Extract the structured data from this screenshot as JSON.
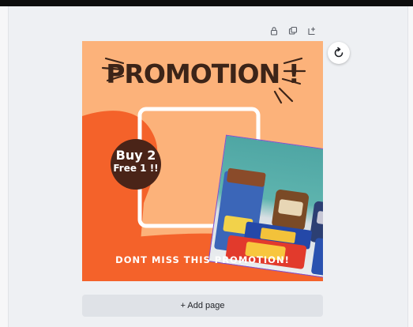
{
  "page_toolbar": {
    "icons": [
      "lock-icon",
      "duplicate-icon",
      "add-page-icon"
    ]
  },
  "design": {
    "title": "PROMOTION !",
    "badge_line1": "Buy 2",
    "badge_line2": "Free 1 !!",
    "bottom_text": "DONT MISS THIS PROMOTION!",
    "colors": {
      "background": "#fcb27a",
      "accent": "#f4622a",
      "dark": "#3c2418",
      "photo_border": "#7b4fd6"
    },
    "product_labels": {
      "kola_kids": "Kola Kids"
    }
  },
  "rotate_button": {
    "icon": "rotate-icon"
  },
  "add_page": {
    "label": "+ Add page"
  }
}
